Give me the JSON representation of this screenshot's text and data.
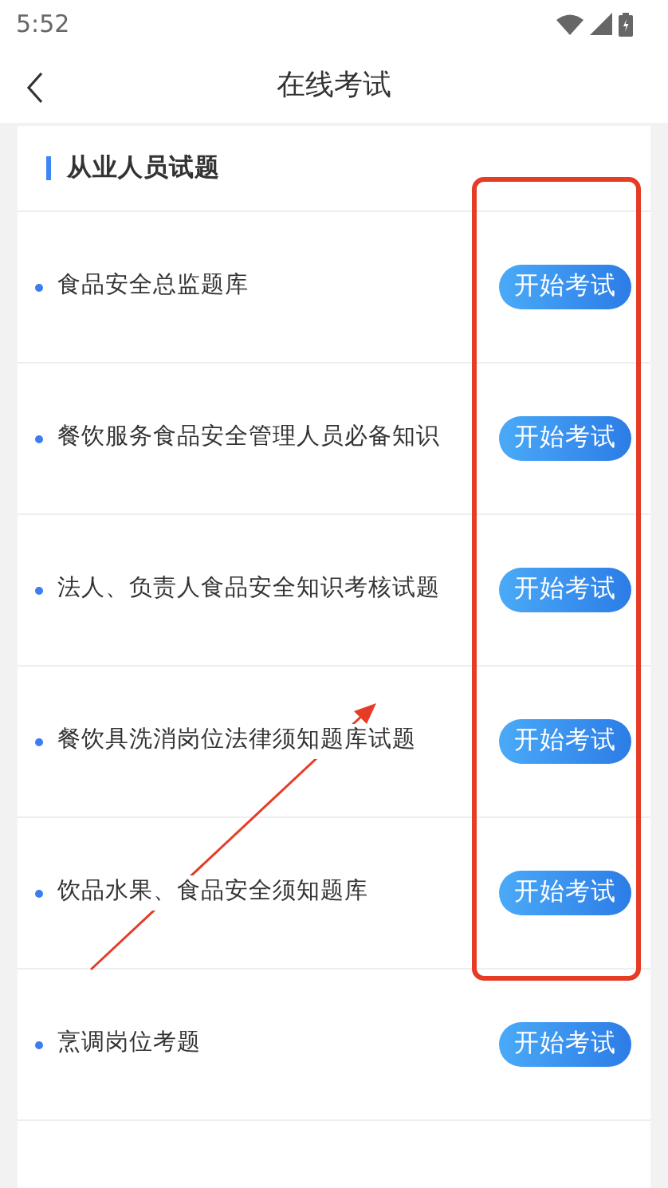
{
  "status_bar": {
    "time": "5:52"
  },
  "header": {
    "title": "在线考试"
  },
  "section": {
    "title": "从业人员试题"
  },
  "exams": [
    {
      "name": "食品安全总监题库",
      "button": "开始考试"
    },
    {
      "name": "餐饮服务食品安全管理人员必备知识",
      "button": "开始考试"
    },
    {
      "name": "法人、负责人食品安全知识考核试题",
      "button": "开始考试"
    },
    {
      "name": "餐饮具洗消岗位法律须知题库试题",
      "button": "开始考试"
    },
    {
      "name": "饮品水果、食品安全须知题库",
      "button": "开始考试"
    },
    {
      "name": "烹调岗位考题",
      "button": "开始考试"
    }
  ]
}
